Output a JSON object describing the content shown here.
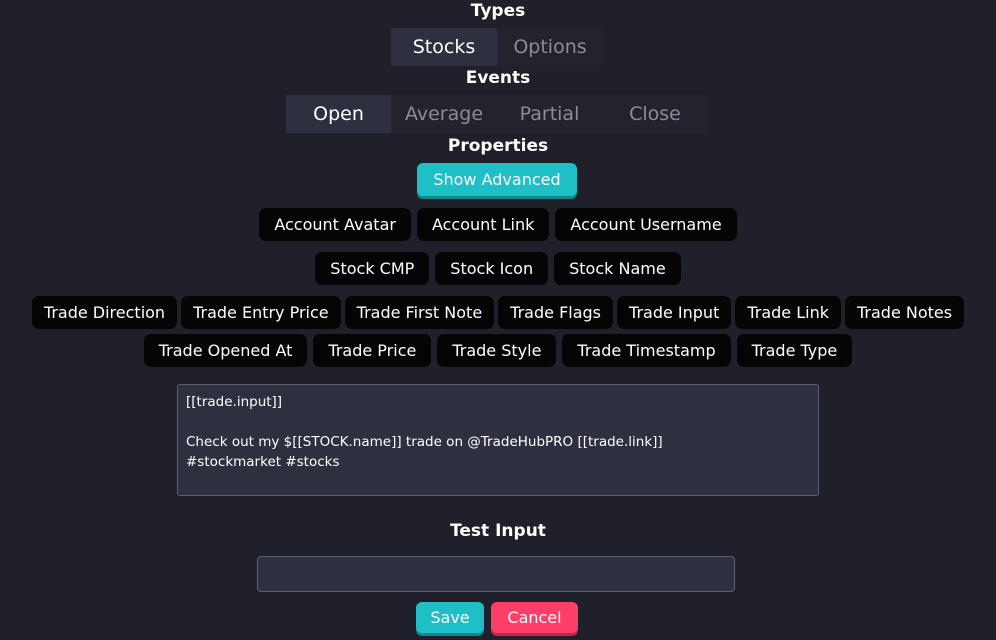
{
  "types": {
    "heading": "Types",
    "options": [
      {
        "label": "Stocks",
        "active": true
      },
      {
        "label": "Options",
        "active": false
      }
    ]
  },
  "events": {
    "heading": "Events",
    "options": [
      {
        "label": "Open",
        "active": true
      },
      {
        "label": "Average",
        "active": false
      },
      {
        "label": "Partial",
        "active": false
      },
      {
        "label": "Close",
        "active": false
      }
    ]
  },
  "properties": {
    "heading": "Properties",
    "show_advanced_label": "Show Advanced",
    "account_row": [
      "Account Avatar",
      "Account Link",
      "Account Username"
    ],
    "stock_row": [
      "Stock CMP",
      "Stock Icon",
      "Stock Name"
    ],
    "trade_row_1": [
      "Trade Direction",
      "Trade Entry Price",
      "Trade First Note",
      "Trade Flags",
      "Trade Input",
      "Trade Link",
      "Trade Notes"
    ],
    "trade_row_2": [
      "Trade Opened At",
      "Trade Price",
      "Trade Style",
      "Trade Timestamp",
      "Trade Type"
    ]
  },
  "template": {
    "text": "[[trade.input]]\n\nCheck out my $[[STOCK.name]] trade on @TradeHubPRO [[trade.link]]\n#stockmarket #stocks"
  },
  "test_input": {
    "heading": "Test Input",
    "value": "",
    "placeholder": ""
  },
  "actions": {
    "save_label": "Save",
    "cancel_label": "Cancel"
  },
  "colors": {
    "background": "#1f2029",
    "accent": "#1fbfc7",
    "danger": "#ff3d69",
    "pill": "#050506"
  }
}
